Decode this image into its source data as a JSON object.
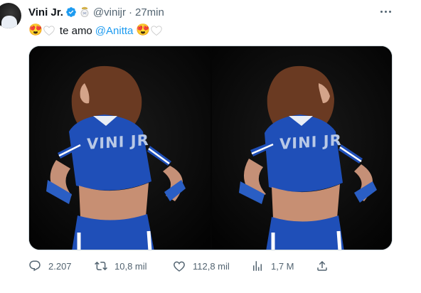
{
  "tweet": {
    "author_name": "Vini Jr.",
    "handle": "@vinijr",
    "separator": "·",
    "time": "27min",
    "text_before": "te amo",
    "mention": "@Anitta",
    "emoji_heart_eyes": "😍",
    "image_text_left": "VINI JR",
    "image_text_right": "VINI JR"
  },
  "actions": {
    "replies": "2.207",
    "retweets": "10,8 mil",
    "likes": "112,8 mil",
    "views": "1,7 M"
  },
  "colors": {
    "accent": "#1d9bf0",
    "secondary_text": "#536471",
    "jersey_blue": "#1f4fb8"
  },
  "icons": [
    "verified-badge-icon",
    "club-crest-icon",
    "more-icon",
    "reply-icon",
    "retweet-icon",
    "like-icon",
    "views-icon",
    "share-icon"
  ]
}
